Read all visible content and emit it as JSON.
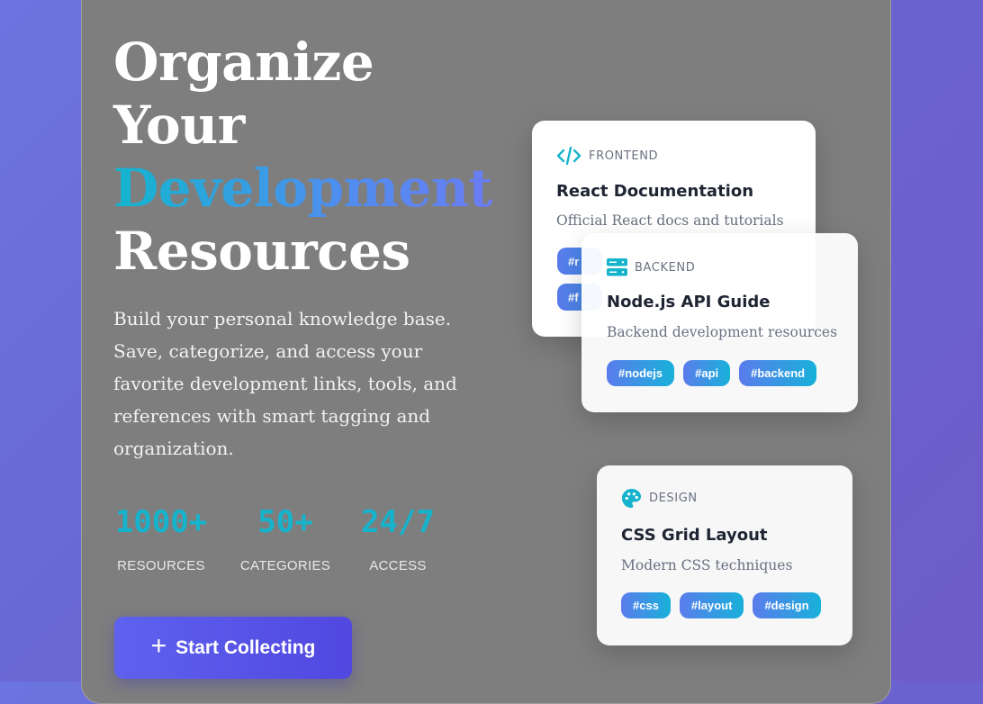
{
  "hero": {
    "title_line1": "Organize",
    "title_line2": "Your",
    "title_accent": "Development",
    "title_line4": "Resources",
    "description": "Build your personal knowledge base. Save, categorize, and access your favorite development links, tools, and references with smart tagging and organization."
  },
  "stats": [
    {
      "value": "1000+",
      "label": "RESOURCES"
    },
    {
      "value": "50+",
      "label": "CATEGORIES"
    },
    {
      "value": "24/7",
      "label": "ACCESS"
    }
  ],
  "cta": {
    "label": "Start Collecting",
    "icon": "plus-icon"
  },
  "cards": [
    {
      "category": "FRONTEND",
      "icon": "code-icon",
      "title": "React Documentation",
      "description": "Official React docs and tutorials",
      "tags_visible": [
        "#r",
        "#f"
      ]
    },
    {
      "category": "BACKEND",
      "icon": "server-icon",
      "title": "Node.js API Guide",
      "description": "Backend development resources",
      "tags": [
        "#nodejs",
        "#api",
        "#backend"
      ]
    },
    {
      "category": "DESIGN",
      "icon": "palette-icon",
      "title": "CSS Grid Layout",
      "description": "Modern CSS techniques",
      "tags": [
        "#css",
        "#layout",
        "#design"
      ]
    }
  ],
  "colors": {
    "accent_cyan": "#16b3cc",
    "cta": "#5a55e8",
    "tag_gradient_start": "#5a7cec",
    "tag_gradient_end": "#18b1da"
  }
}
